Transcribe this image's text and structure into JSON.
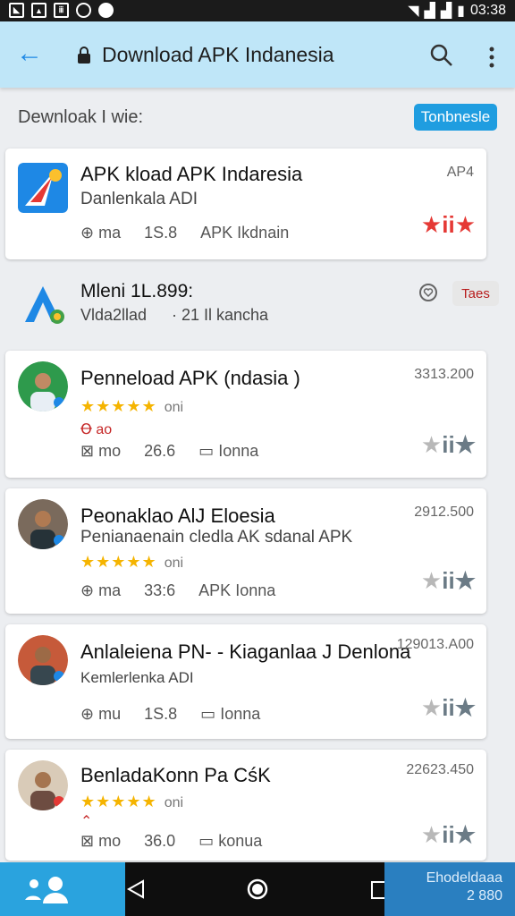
{
  "status_bar": {
    "time": "03:38"
  },
  "app_bar": {
    "title": "Download APK Indanesia"
  },
  "filter": {
    "label": "Dewnloak I wie:",
    "button_label": "Tonbnesle"
  },
  "cards": [
    {
      "title": "APK kload APK Indaresia",
      "subtitle": "Danlenkala ADI",
      "price": "AP4",
      "meta": [
        "ma",
        "1S.8",
        "APK Ikdnain"
      ],
      "rating_style": "red"
    },
    {
      "title": "Penneload APK (ndasia  )",
      "stars_text": "oni",
      "tag": "Ꝋ ao",
      "price": "3313.200",
      "meta": [
        "mo",
        "26.6",
        "Ionna"
      ]
    },
    {
      "title": "Peonaklao AlJ Eloesia",
      "subtitle": "Penianaenain cledla AK sdanal APK",
      "stars_text": "oni",
      "price": "2912.500",
      "meta": [
        "ma",
        "33:6",
        "APK Ionna"
      ]
    },
    {
      "title": "Anlaleiena PN- - Kiaganlaa J Denlona",
      "subtitle": "Kemlerlenka ADI",
      "price": "129013.A00",
      "meta": [
        "mu",
        "1S.8",
        "Ionna"
      ]
    },
    {
      "title": "BenladaKonn Pa CśK",
      "stars_text": "oni",
      "tag": "⌃",
      "price": "22623.450",
      "meta": [
        "mo",
        "36.0",
        "konua"
      ]
    }
  ],
  "plain_item": {
    "title": "Mleni 1L.899:",
    "subtitle": "Vlda2llad",
    "extra": "21 Il kancha",
    "badge": "Taes"
  },
  "nav": {
    "right_label_1": "Ehodeldaaa",
    "right_label_2": "2 880"
  },
  "colors": {
    "accent": "#1f9de0",
    "appbar": "#bfe6f8",
    "star": "#f5b400",
    "red": "#e53935"
  }
}
